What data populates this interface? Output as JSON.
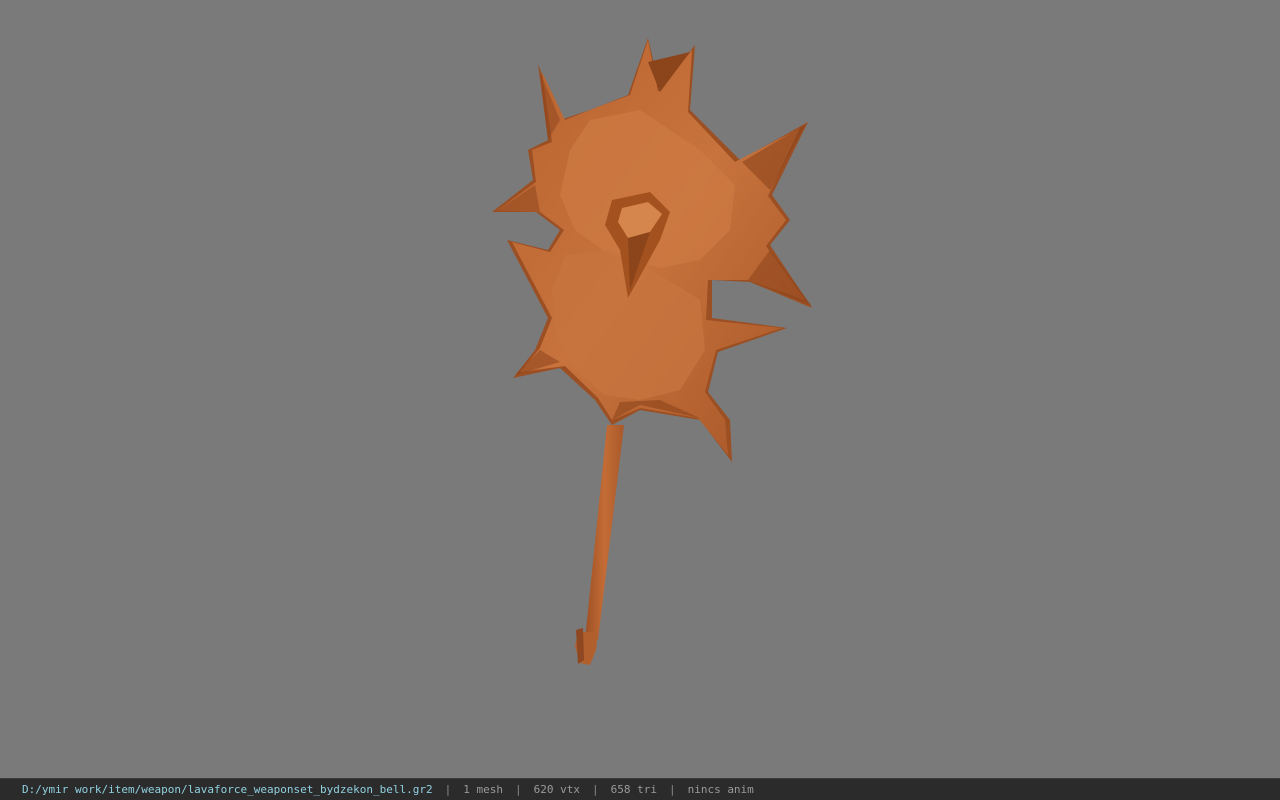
{
  "viewer": {
    "background_color": "#7a7a7a",
    "model_color": "#c06a35",
    "model_name": "lavaforce_weaponset_bydzekon_bell"
  },
  "status": {
    "file_path": "D:/ymir work/item/weapon/lavaforce_weaponset_bydzekon_bell.gr2",
    "mesh_count": "1 mesh",
    "vertex_count": "620 vtx",
    "triangle_count": "658 tri",
    "anim_status": "nincs anim",
    "separator": "|"
  }
}
